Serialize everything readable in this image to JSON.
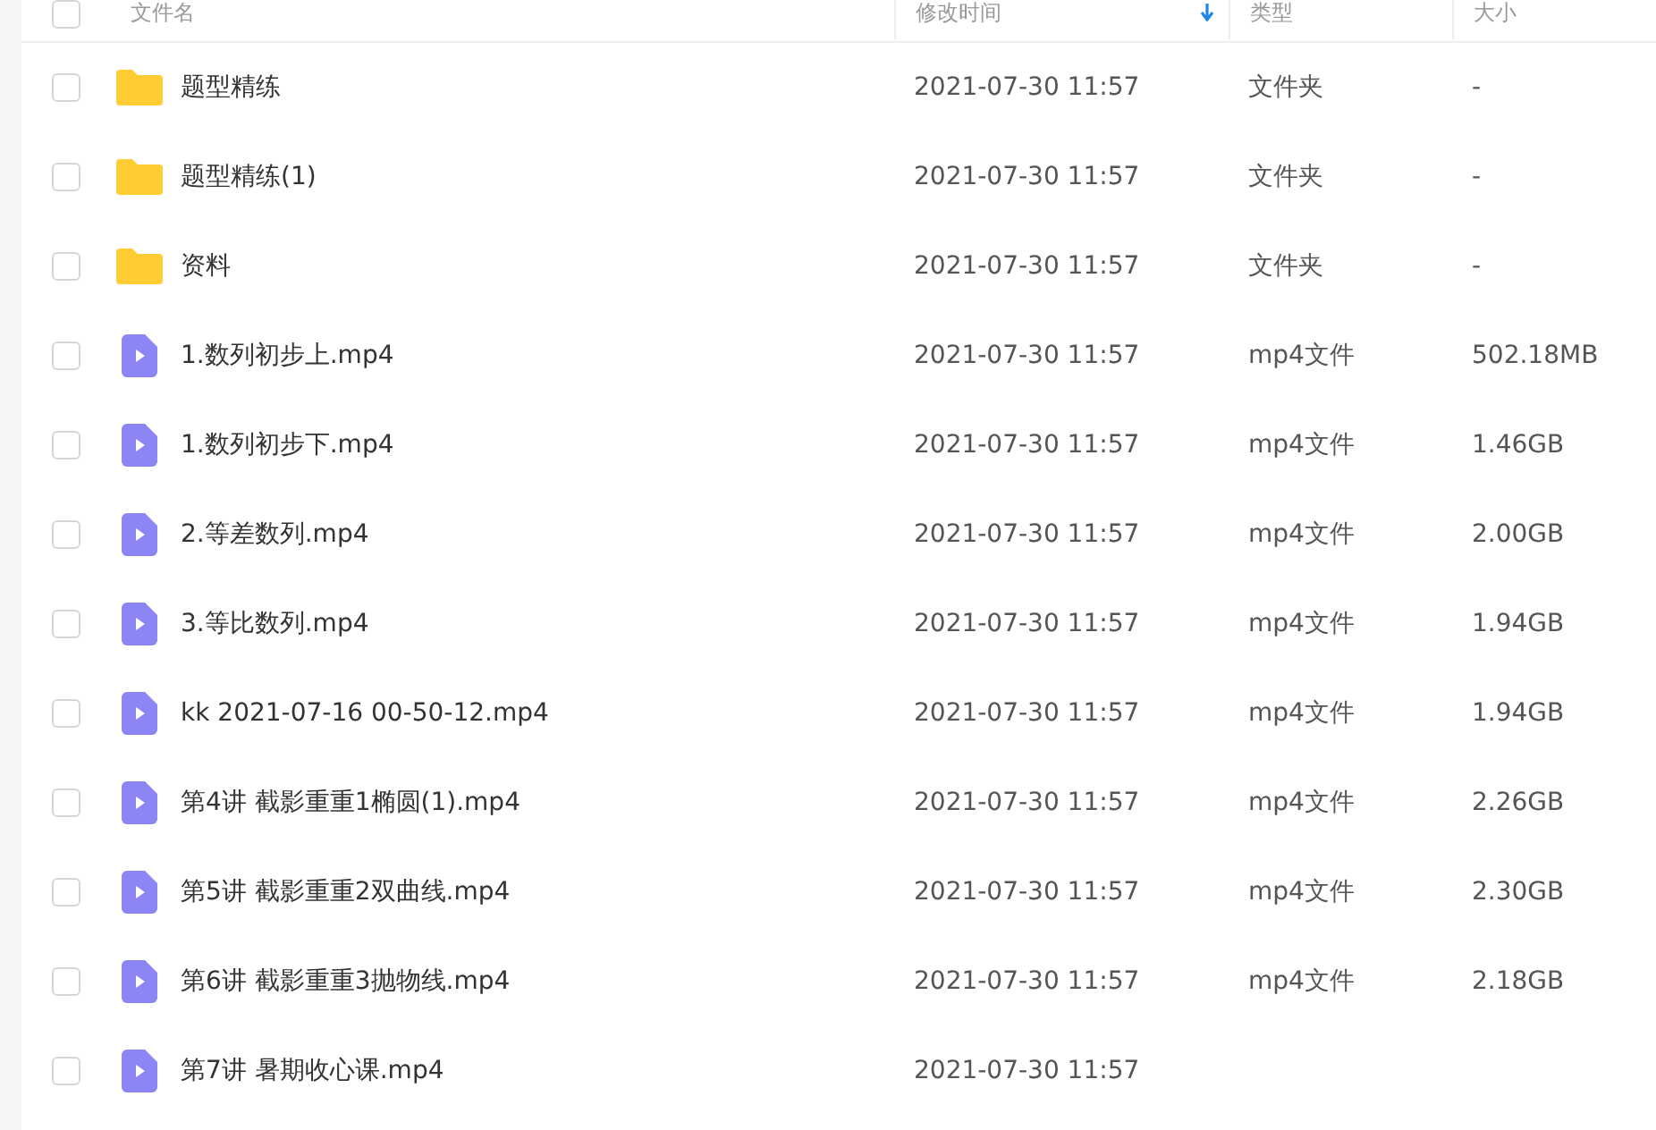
{
  "table": {
    "all_checked": false,
    "columns": [
      {
        "label": "文件名"
      },
      {
        "label": "修改时间",
        "sorted": true
      },
      {
        "label": "类型"
      },
      {
        "label": "大小"
      }
    ],
    "rows": [
      {
        "kind": "folder",
        "checked": false,
        "name": "题型精练",
        "modified": "2021-07-30 11:57",
        "type": "文件夹",
        "size": "-"
      },
      {
        "kind": "folder",
        "checked": false,
        "name": "题型精练(1)",
        "modified": "2021-07-30 11:57",
        "type": "文件夹",
        "size": "-"
      },
      {
        "kind": "folder",
        "checked": false,
        "name": "资料",
        "modified": "2021-07-30 11:57",
        "type": "文件夹",
        "size": "-"
      },
      {
        "kind": "video",
        "checked": false,
        "name": "1.数列初步上.mp4",
        "modified": "2021-07-30 11:57",
        "type": "mp4文件",
        "size": "502.18MB"
      },
      {
        "kind": "video",
        "checked": false,
        "name": "1.数列初步下.mp4",
        "modified": "2021-07-30 11:57",
        "type": "mp4文件",
        "size": "1.46GB"
      },
      {
        "kind": "video",
        "checked": false,
        "name": "2.等差数列.mp4",
        "modified": "2021-07-30 11:57",
        "type": "mp4文件",
        "size": "2.00GB"
      },
      {
        "kind": "video",
        "checked": false,
        "name": "3.等比数列.mp4",
        "modified": "2021-07-30 11:57",
        "type": "mp4文件",
        "size": "1.94GB"
      },
      {
        "kind": "video",
        "checked": false,
        "name": "kk 2021-07-16 00-50-12.mp4",
        "modified": "2021-07-30 11:57",
        "type": "mp4文件",
        "size": "1.94GB"
      },
      {
        "kind": "video",
        "checked": false,
        "name": "第4讲 截影重重1椭圆(1).mp4",
        "modified": "2021-07-30 11:57",
        "type": "mp4文件",
        "size": "2.26GB"
      },
      {
        "kind": "video",
        "checked": false,
        "name": "第5讲 截影重重2双曲线.mp4",
        "modified": "2021-07-30 11:57",
        "type": "mp4文件",
        "size": "2.30GB"
      },
      {
        "kind": "video",
        "checked": false,
        "name": "第6讲 截影重重3抛物线.mp4",
        "modified": "2021-07-30 11:57",
        "type": "mp4文件",
        "size": "2.18GB"
      },
      {
        "kind": "video",
        "checked": false,
        "name": "第7讲 暑期收心课.mp4",
        "modified": "2021-07-30 11:57"
      }
    ]
  }
}
